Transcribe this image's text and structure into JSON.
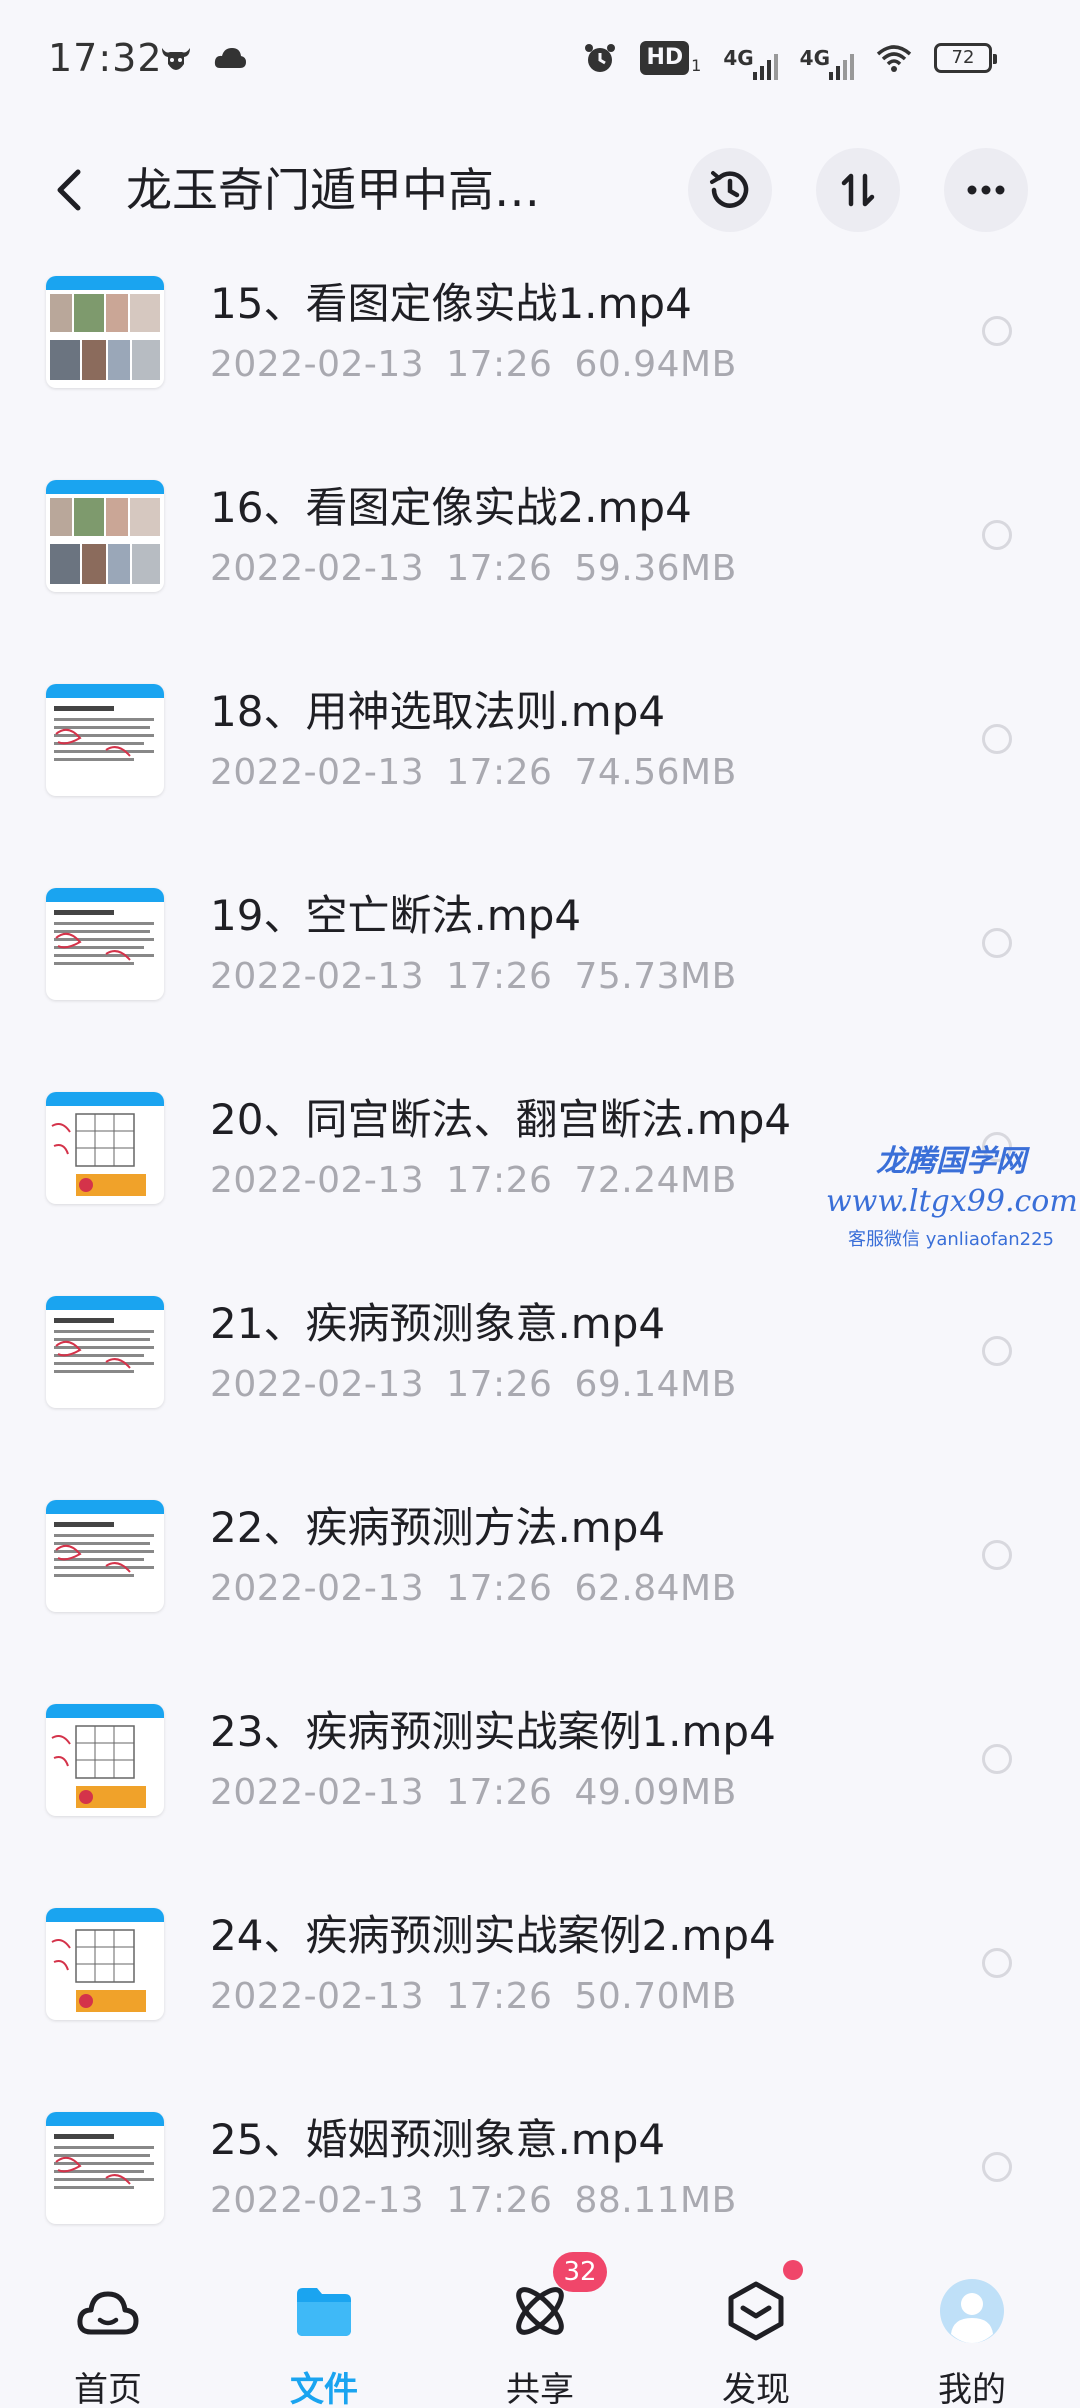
{
  "status_bar": {
    "time": "17:32",
    "hd_label": "HD",
    "hd_sub": "1",
    "net1": "4G",
    "net2": "4G",
    "battery": "72"
  },
  "header": {
    "title": "龙玉奇门遁甲中高…",
    "icons": [
      "back-icon",
      "history-icon",
      "sort-icon",
      "more-icon"
    ]
  },
  "files": [
    {
      "name": "15、看图定像实战1.mp4",
      "date": "2022-02-13",
      "time": "17:26",
      "size": "60.94MB",
      "thumb": "photos"
    },
    {
      "name": "16、看图定像实战2.mp4",
      "date": "2022-02-13",
      "time": "17:26",
      "size": "59.36MB",
      "thumb": "photos"
    },
    {
      "name": "18、用神选取法则.mp4",
      "date": "2022-02-13",
      "time": "17:26",
      "size": "74.56MB",
      "thumb": "text"
    },
    {
      "name": "19、空亡断法.mp4",
      "date": "2022-02-13",
      "time": "17:26",
      "size": "75.73MB",
      "thumb": "text"
    },
    {
      "name": "20、同宫断法、翻宫断法.mp4",
      "date": "2022-02-13",
      "time": "17:26",
      "size": "72.24MB",
      "thumb": "grid"
    },
    {
      "name": "21、疾病预测象意.mp4",
      "date": "2022-02-13",
      "time": "17:26",
      "size": "69.14MB",
      "thumb": "text"
    },
    {
      "name": "22、疾病预测方法.mp4",
      "date": "2022-02-13",
      "time": "17:26",
      "size": "62.84MB",
      "thumb": "text"
    },
    {
      "name": "23、疾病预测实战案例1.mp4",
      "date": "2022-02-13",
      "time": "17:26",
      "size": "49.09MB",
      "thumb": "grid"
    },
    {
      "name": "24、疾病预测实战案例2.mp4",
      "date": "2022-02-13",
      "time": "17:26",
      "size": "50.70MB",
      "thumb": "grid"
    },
    {
      "name": "25、婚姻预测象意.mp4",
      "date": "2022-02-13",
      "time": "17:26",
      "size": "88.11MB",
      "thumb": "text"
    }
  ],
  "watermark": {
    "title": "龙腾国学网",
    "url": "www.ltgx99.com",
    "contact": "客服微信 yanliaofan225"
  },
  "bottom_nav": {
    "items": [
      {
        "label": "首页",
        "icon": "cloud-icon",
        "active": false
      },
      {
        "label": "文件",
        "icon": "folder-icon",
        "active": true
      },
      {
        "label": "共享",
        "icon": "atom-icon",
        "active": false,
        "badge": "32"
      },
      {
        "label": "发现",
        "icon": "cube-icon",
        "active": false,
        "dot": true
      },
      {
        "label": "我的",
        "icon": "avatar-icon",
        "active": false
      }
    ]
  },
  "colors": {
    "accent": "#1aa4f0",
    "badge": "#f0466a",
    "meta_text": "#a9a9b0",
    "background": "#f7f7fb",
    "watermark": "#3a6fd8"
  }
}
